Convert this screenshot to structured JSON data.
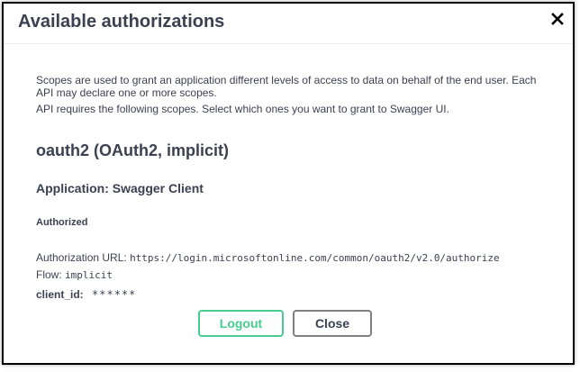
{
  "dialog": {
    "title": "Available authorizations",
    "close_icon": "close-x-icon"
  },
  "scopes": {
    "description": "Scopes are used to grant an application different levels of access to data on behalf of the end user. Each API may declare one or more scopes.",
    "requirement": "API requires the following scopes. Select which ones you want to grant to Swagger UI."
  },
  "scheme": {
    "title": "oauth2 (OAuth2, implicit)",
    "application_label": "Application:",
    "application_value": "Swagger Client",
    "status": "Authorized",
    "auth_url_label": "Authorization URL:",
    "auth_url_value": "https://login.microsoftonline.com/common/oauth2/v2.0/authorize",
    "flow_label": "Flow:",
    "flow_value": "implicit",
    "client_id_label": "client_id:",
    "client_id_value": "******"
  },
  "buttons": {
    "logout": "Logout",
    "close": "Close"
  },
  "colors": {
    "logout_accent": "#49cc90",
    "text": "#3b4151",
    "border": "#000000"
  }
}
